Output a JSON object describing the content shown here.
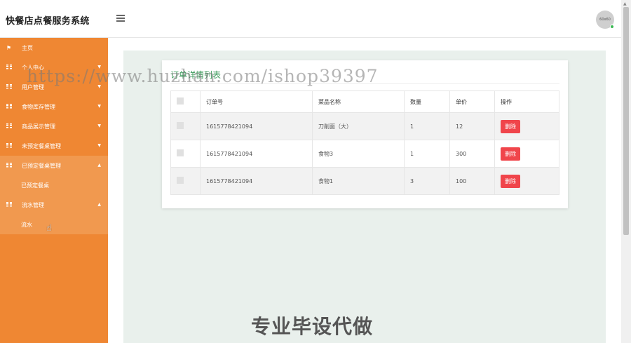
{
  "app": {
    "title": "快餐店点餐服务系统",
    "avatar_text": "60x60"
  },
  "sidebar": {
    "items": [
      {
        "label": "主页",
        "icon": "flag-icon"
      },
      {
        "label": "个人中心",
        "icon": "grid-icon"
      },
      {
        "label": "用户管理",
        "icon": "grid-icon"
      },
      {
        "label": "食物库存管理",
        "icon": "grid-icon"
      },
      {
        "label": "商品展示管理",
        "icon": "grid-icon"
      },
      {
        "label": "未预定餐桌管理",
        "icon": "grid-icon"
      },
      {
        "label": "已预定餐桌管理",
        "icon": "grid-icon",
        "sub": "已预定餐桌"
      },
      {
        "label": "流水管理",
        "icon": "grid-icon",
        "sub": "流水"
      }
    ]
  },
  "card": {
    "title": "订单详情列表",
    "columns": [
      "订单号",
      "菜品名称",
      "数量",
      "单价",
      "操作"
    ],
    "rows": [
      {
        "order_no": "1615778421094",
        "dish": "刀削面（大）",
        "qty": "1",
        "price": "12",
        "action": "删除"
      },
      {
        "order_no": "1615778421094",
        "dish": "食物3",
        "qty": "1",
        "price": "300",
        "action": "删除"
      },
      {
        "order_no": "1615778421094",
        "dish": "食物1",
        "qty": "3",
        "price": "100",
        "action": "删除"
      }
    ]
  },
  "overlay": {
    "watermark": "https://www.huzhan.com/ishop39397",
    "banner": "专业毕设代做"
  },
  "colors": {
    "sidebar": "#ef8733",
    "accent_title": "#3a9a5a",
    "delete": "#f0454b"
  }
}
